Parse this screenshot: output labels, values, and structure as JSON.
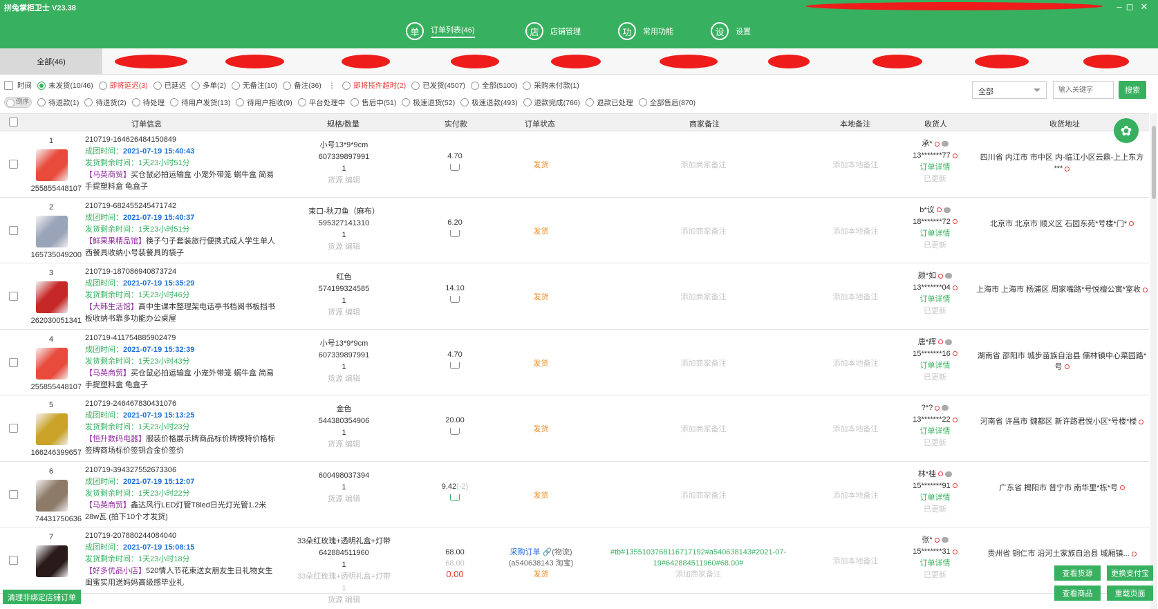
{
  "app": {
    "title": "拼兔掌柜卫士 V23.38"
  },
  "nav": [
    {
      "icon_char": "单",
      "label": "订单列表(46)",
      "active": true
    },
    {
      "icon_char": "店",
      "label": "店铺管理"
    },
    {
      "icon_char": "功",
      "label": "常用功能"
    },
    {
      "icon_char": "设",
      "label": "设置"
    }
  ],
  "stores": {
    "all_label": "全部(46)"
  },
  "filters": {
    "time_label": "时间",
    "row1": [
      {
        "label": "未发货(10/46)",
        "checked": true
      },
      {
        "label": "即将延迟(3)",
        "red": true
      },
      {
        "label": "已延迟"
      },
      {
        "label": "多单(2)"
      },
      {
        "label": "无备注(10)"
      },
      {
        "label": "备注(36)"
      },
      {
        "label": "即将揽件超时(2)",
        "red": true
      },
      {
        "label": "已发货(4507)"
      },
      {
        "label": "全部(5100)"
      },
      {
        "label": "采购未付款(1)"
      }
    ],
    "toggle_label": "倒序",
    "row2": [
      {
        "label": "待退款(1)"
      },
      {
        "label": "待退货(2)"
      },
      {
        "label": "待处理"
      },
      {
        "label": "待用户发货(13)"
      },
      {
        "label": "待用户拒收(9)"
      },
      {
        "label": "平台处理中"
      },
      {
        "label": "售后中(51)"
      },
      {
        "label": "极速退货(52)"
      },
      {
        "label": "极速退款(493)"
      },
      {
        "label": "退款完成(766)"
      },
      {
        "label": "退款已处理"
      },
      {
        "label": "全部售后(870)"
      }
    ],
    "select_value": "全部",
    "search_placeholder": "输入关键字",
    "search_label": "搜索"
  },
  "columns": {
    "order_info": "订单信息",
    "spec": "规格/数量",
    "paid": "实付款",
    "status": "订单状态",
    "merchant_note": "商家备注",
    "local_note": "本地备注",
    "receiver": "收货人",
    "address": "收货地址"
  },
  "labels": {
    "group_time": "成团时间：",
    "remain_time": "发货剩余时间：",
    "source_edit": "货源 编辑",
    "ship": "发货",
    "add_merchant_note": "添加商家备注",
    "add_local_note": "添加本地备注",
    "order_detail": "订单详情",
    "updated": "已更新"
  },
  "orders": [
    {
      "idx": "1",
      "goods_id": "255855448107",
      "order_no": "210719-164626484150849",
      "group_time": "2021-07-19 15:40:43",
      "remain": "1天23小时51分",
      "shop": "【马英商贸】",
      "title": "买仓鼠必拍运输盒 小宠外带笼 蜗牛盒 简易手提塑料盒 龟盒子",
      "spec": "小号13*9*9cm",
      "sku": "607339897991",
      "qty": "1",
      "paid": "4.70",
      "receiver": "承*",
      "phone": "13*******77",
      "address": "四川省 内江市 市中区 内-临江小区云鼎-上上东方***",
      "img": "#e84a3c"
    },
    {
      "idx": "2",
      "goods_id": "165735049200",
      "order_no": "210719-682455245471742",
      "group_time": "2021-07-19 15:40:37",
      "remain": "1天23小时51分",
      "shop": "【鲜果果精品馆】",
      "title": "筷子勺子套装旅行便携式成人学生单人西餐具收纳小号装餐具的袋子",
      "spec": "束口-秋刀鱼（麻布）",
      "sku": "595327141310",
      "qty": "1",
      "paid": "6.20",
      "receiver": "b*议",
      "phone": "18*******72",
      "address": "北京市 北京市 顺义区 石园东苑*号楼*门*",
      "img": "#9aa4b8"
    },
    {
      "idx": "3",
      "goods_id": "262030051341",
      "order_no": "210719-187086940873724",
      "group_time": "2021-07-19 15:35:29",
      "remain": "1天23小时46分",
      "shop": "【大韩生活馆】",
      "title": "高中生课本整理架电话亭书档阅书板挡书板收纳书靠多功能办公桌屋",
      "spec": "红色",
      "sku": "574199324585",
      "qty": "1",
      "paid": "14.10",
      "receiver": "颜*如",
      "phone": "13*******04",
      "address": "上海市 上海市 杨浦区 周家嘴路*号悦檀公寓*室收",
      "img": "#c62828"
    },
    {
      "idx": "4",
      "goods_id": "255855448107",
      "order_no": "210719-411754885902479",
      "group_time": "2021-07-19 15:32:39",
      "remain": "1天23小时43分",
      "shop": "【马英商贸】",
      "title": "买仓鼠必拍运输盒 小宠外带笼 蜗牛盒 简易手提塑料盒 龟盒子",
      "spec": "小号13*9*9cm",
      "sku": "607339897991",
      "qty": "1",
      "paid": "4.70",
      "receiver": "唐*辉",
      "phone": "15*******16",
      "address": "湖南省 邵阳市 城步苗族自治县 儒林镇中心菜园路*号",
      "img": "#e84a3c"
    },
    {
      "idx": "5",
      "goods_id": "166246399657",
      "order_no": "210719-246467830431076",
      "group_time": "2021-07-19 15:13:25",
      "remain": "1天23小时23分",
      "shop": "【恒升数码电器】",
      "title": "服装价格展示牌商品标价牌模特价格标签牌商场标价签钥合金价签价",
      "spec": "金色",
      "sku": "544380354906",
      "qty": "1",
      "paid": "20.00",
      "receiver": "?*?",
      "phone": "13*******22",
      "address": "河南省 许昌市 魏都区 新许路君悦小区*号楼*楼",
      "img": "#c9a227"
    },
    {
      "idx": "6",
      "goods_id": "74431750636",
      "order_no": "210719-394327552673306",
      "group_time": "2021-07-19 15:12:07",
      "remain": "1天23小时22分",
      "shop": "【马英商贸】",
      "title": "鑫达风行LED灯管T8led日光灯光管1.2米28w瓦 (拍下10个才发货)",
      "spec": "",
      "sku": "600498037394",
      "qty": "1",
      "paid": "9.42",
      "paid_extra": "(-2)",
      "receiver": "林*桂",
      "phone": "15*******91",
      "address": "广东省 揭阳市 普宁市 南华里*栋*号",
      "img": "#8d7b68"
    },
    {
      "idx": "7",
      "goods_id": "",
      "order_no": "210719-207880244084040",
      "group_time": "2021-07-19 15:08:15",
      "remain": "1天23小时18分",
      "shop": "【好多优品小店】",
      "title": "520情人节花束送女朋友生日礼物女生闺蜜实用送妈妈高级感毕业礼",
      "spec": "33朵红玫瑰+透明礼盒+灯带",
      "sku": "642884511960",
      "qty": "1",
      "paid": "68.00",
      "receiver": "张*",
      "phone": "15*******31",
      "address": "贵州省 铜仁市 沿河土家族自治县 城厢镇...",
      "img": "#2a1a1a"
    }
  ],
  "order7_extra": {
    "procure": "采购订单",
    "logistics": "(物流)",
    "ref": "(a540638143 淘宝)",
    "paid2": "68.00",
    "paid3": "0.00",
    "spec_gray": "33朵红玫瑰+透明礼盒+灯带",
    "qty_gray": "1",
    "note": "#tb#1355103768116717192#a540638143#2021-07-19#642884511960#68.00#"
  },
  "bottom": {
    "clear_btn": "清理非绑定店铺订单",
    "view_source": "查看货源",
    "change_pay": "更换支付宝",
    "view_goods": "查看商品",
    "reload": "重载页面"
  },
  "colors": {
    "brand": "#37b15f",
    "redact": "#ef1c1c",
    "warn": "#f08a24",
    "link": "#1e6fd9"
  }
}
